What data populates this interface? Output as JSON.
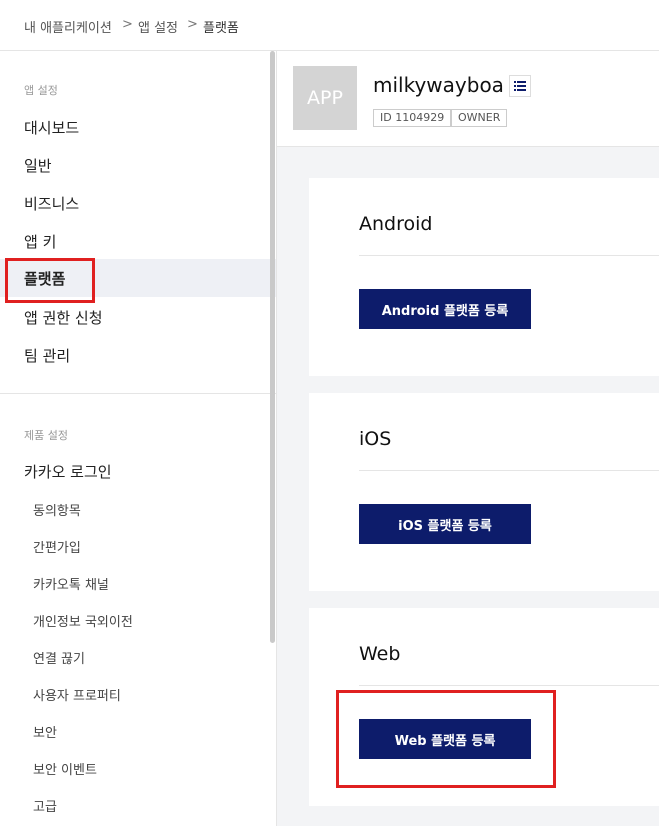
{
  "breadcrumb": {
    "items": [
      "내 애플리케이션",
      "앱 설정",
      "플랫폼"
    ],
    "separator": ">"
  },
  "sidebar": {
    "section1_label": "앱 설정",
    "section1_items": [
      "대시보드",
      "일반",
      "비즈니스",
      "앱 키",
      "플랫폼",
      "앱 권한 신청",
      "팀 관리"
    ],
    "active_item": "플랫폼",
    "section2_label": "제품 설정",
    "kakao_login": "카카오 로그인",
    "kakao_login_sub": [
      "동의항목",
      "간편가입",
      "카카오톡 채널",
      "개인정보 국외이전",
      "연결 끊기",
      "사용자 프로퍼티",
      "보안",
      "보안 이벤트",
      "고급"
    ]
  },
  "app": {
    "thumb_text": "APP",
    "name": "milkywayboa",
    "id_tag": "ID 1104929",
    "role_tag": "OWNER"
  },
  "platforms": [
    {
      "title": "Android",
      "button": "Android 플랫폼 등록"
    },
    {
      "title": "iOS",
      "button": "iOS 플랫폼 등록"
    },
    {
      "title": "Web",
      "button": "Web 플랫폼 등록"
    }
  ],
  "colors": {
    "button_bg": "#0d1c6b",
    "highlight": "#e02020",
    "active_bg": "#eef0f5"
  }
}
